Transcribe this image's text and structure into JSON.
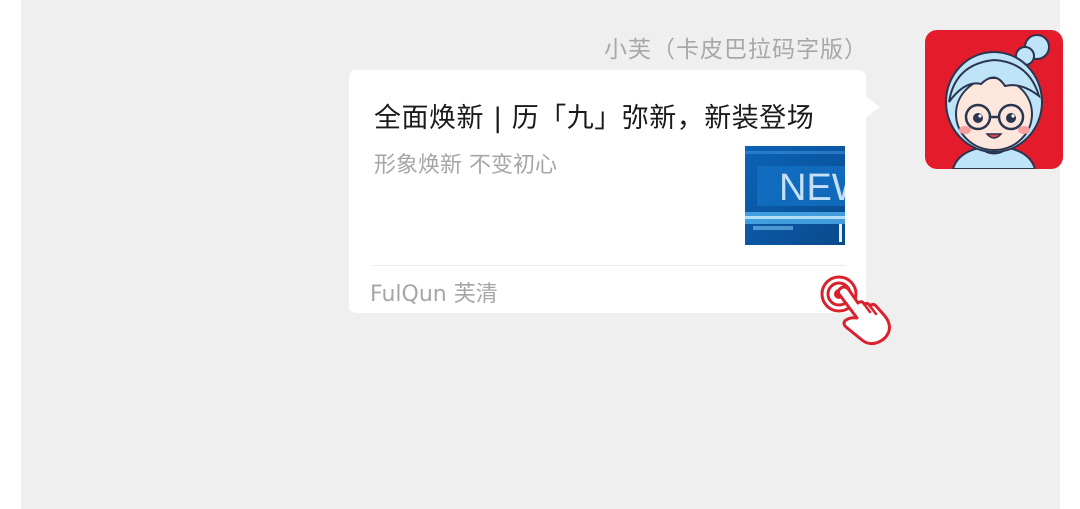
{
  "chat": {
    "sender_name": "小芙（卡皮巴拉码字版）",
    "avatar_icon": "cartoon-girl-avatar",
    "avatar_bg": "#e31b2a"
  },
  "card": {
    "title": "全面焕新 | 历「九」弥新，新装登场",
    "description": "形象焕新 不变初心",
    "thumbnail_text": "NEW",
    "source": "FulQun 芙清"
  },
  "tap_hint_icon": "tap-hand-icon",
  "colors": {
    "chat_background": "#efefef",
    "accent_red": "#d9222e",
    "thumbnail_blue": "#0a5aa8"
  }
}
